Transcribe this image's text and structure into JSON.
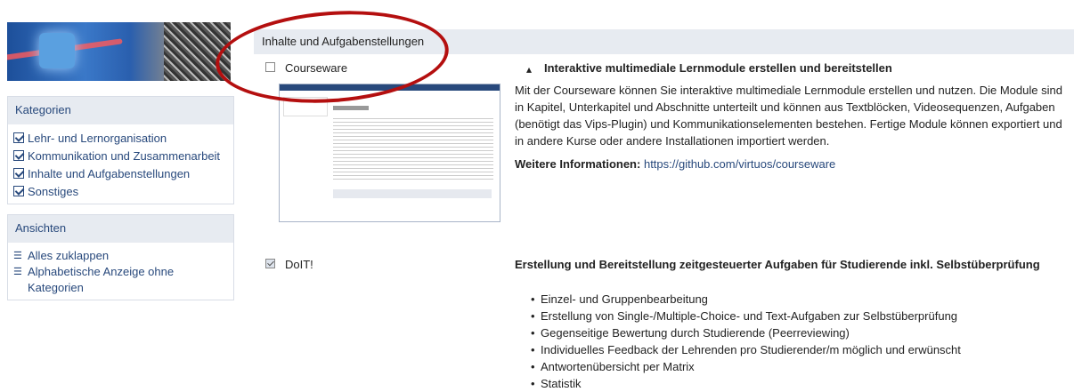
{
  "sidebar": {
    "categories": {
      "title": "Kategorien",
      "items": [
        {
          "label": "Lehr- und Lernorganisation",
          "checked": true
        },
        {
          "label": "Kommunikation und Zusammenarbeit",
          "checked": true
        },
        {
          "label": "Inhalte und Aufgabenstellungen",
          "checked": true
        },
        {
          "label": "Sonstiges",
          "checked": true
        }
      ]
    },
    "views": {
      "title": "Ansichten",
      "items": [
        {
          "label": "Alles zuklappen",
          "icon": "list-icon"
        },
        {
          "label": "Alphabetische Anzeige ohne",
          "label2": "Kategorien",
          "icon": "list-icon"
        }
      ]
    }
  },
  "main": {
    "section_title": "Inhalte und Aufgabenstellungen",
    "plugins": [
      {
        "name": "Courseware",
        "checked": false,
        "headline_icon": "sitemap-icon",
        "headline": "Interaktive multimediale Lernmodule erstellen und bereitstellen",
        "description": "Mit der Courseware können Sie interaktive multimediale Lernmodule erstellen und nutzen. Die Module sind in Kapitel, Unterkapitel und Abschnitte unterteilt und können aus Textblöcken, Videosequenzen, Aufgaben (benötigt das Vips-Plugin) und Kommunikationselementen bestehen. Fertige Module können exportiert und in andere Kurse oder andere Installationen importiert werden.",
        "info_label": "Weitere Informationen:",
        "info_link": "https://github.com/virtuos/courseware",
        "screenshot_heading": "Abschnitt 2"
      },
      {
        "name": "DoIT!",
        "checked": true,
        "headline": "Erstellung und Bereitstellung zeitgesteuerter Aufgaben für Studierende inkl. Selbstüberprüfung",
        "features": [
          "Einzel- und Gruppenbearbeitung",
          "Erstellung von Single-/Multiple-Choice- und Text-Aufgaben zur Selbstüberprüfung",
          "Gegenseitige Bewertung durch Studierende (Peerreviewing)",
          "Individuelles Feedback der Lehrenden pro Studierender/m möglich und erwünscht",
          "Antwortenübersicht per Matrix",
          "Statistik"
        ]
      }
    ]
  },
  "colors": {
    "accent": "#28497c",
    "header_bg": "#e7ebf1",
    "annotation": "#b40f0f"
  }
}
